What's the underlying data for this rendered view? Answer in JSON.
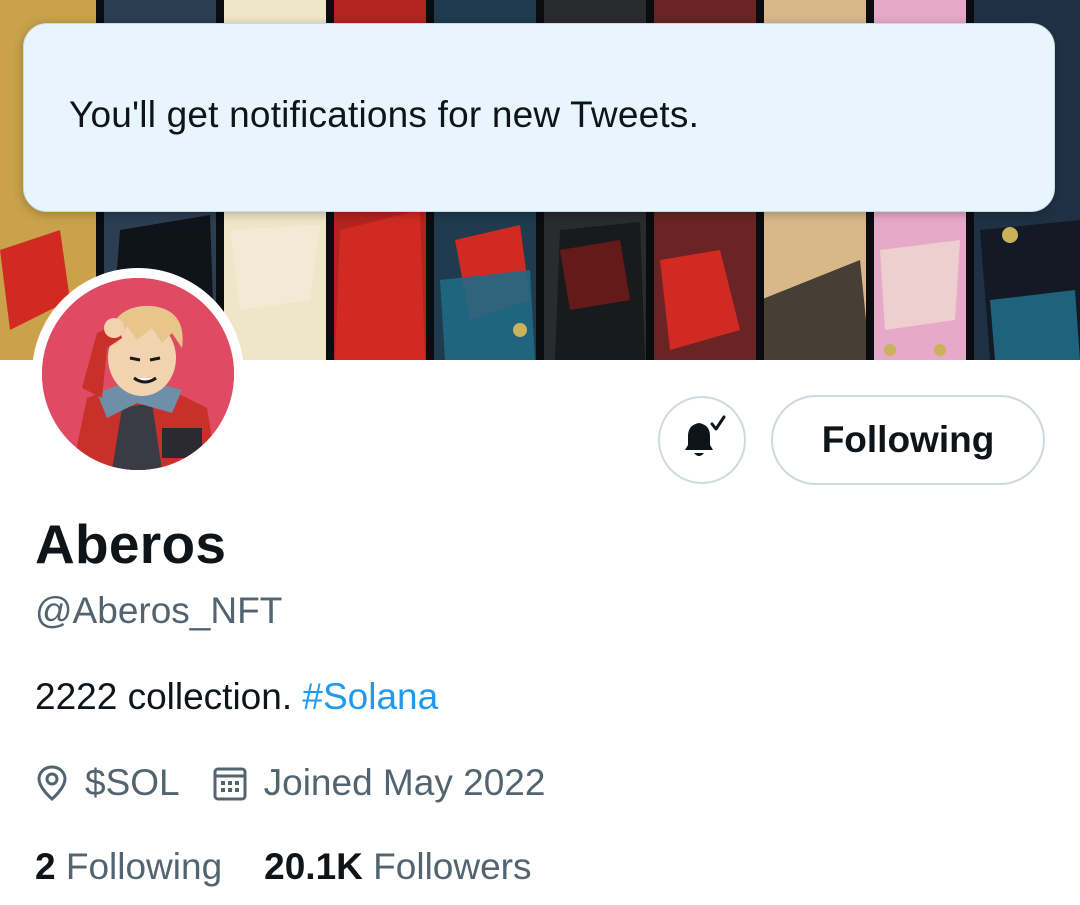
{
  "toast": {
    "message": "You'll get notifications for new Tweets."
  },
  "profile": {
    "display_name": "Aberos",
    "handle": "@Aberos_NFT",
    "bio_text": "2222 collection.",
    "bio_hashtag": "#Solana",
    "location": "$SOL",
    "joined": "Joined May 2022",
    "following_count": "2",
    "following_label": "Following",
    "followers_count": "20.1K",
    "followers_label": "Followers"
  },
  "actions": {
    "follow_button_label": "Following",
    "notification_icon": "bell-check-icon"
  },
  "icons": {
    "location": "location-pin-icon",
    "calendar": "calendar-icon"
  },
  "colors": {
    "link": "#1d9bf0",
    "secondary_text": "#536471",
    "toast_bg": "#e8f5fd"
  }
}
